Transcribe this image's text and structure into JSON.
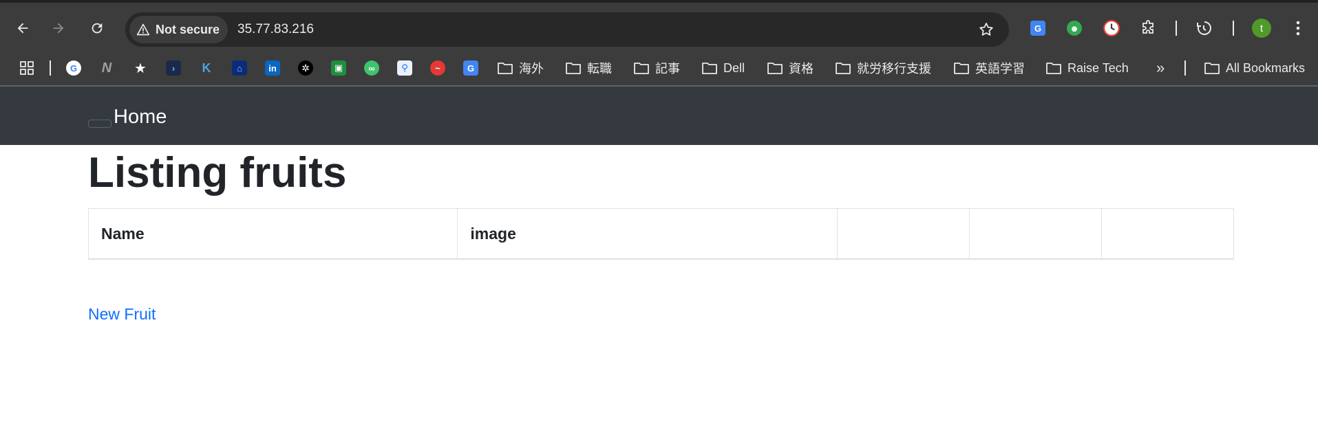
{
  "browser": {
    "security_label": "Not secure",
    "url": "35.77.83.216",
    "profile_initial": "t"
  },
  "bookmarks": {
    "folders": [
      "海外",
      "転職",
      "記事",
      "Dell",
      "資格",
      "就労移行支援",
      "英語学習",
      "Raise Tech"
    ],
    "more_label": "»",
    "all_bookmarks": "All Bookmarks"
  },
  "navbar": {
    "brand": "Home"
  },
  "main": {
    "title": "Listing fruits",
    "table": {
      "headers": [
        "Name",
        "image",
        "",
        "",
        ""
      ]
    },
    "new_link": "New Fruit"
  },
  "colors": {
    "chrome_bg": "#3c3c3c",
    "navbar_bg": "#343a40",
    "link": "#0d6efd",
    "text": "#212529"
  }
}
